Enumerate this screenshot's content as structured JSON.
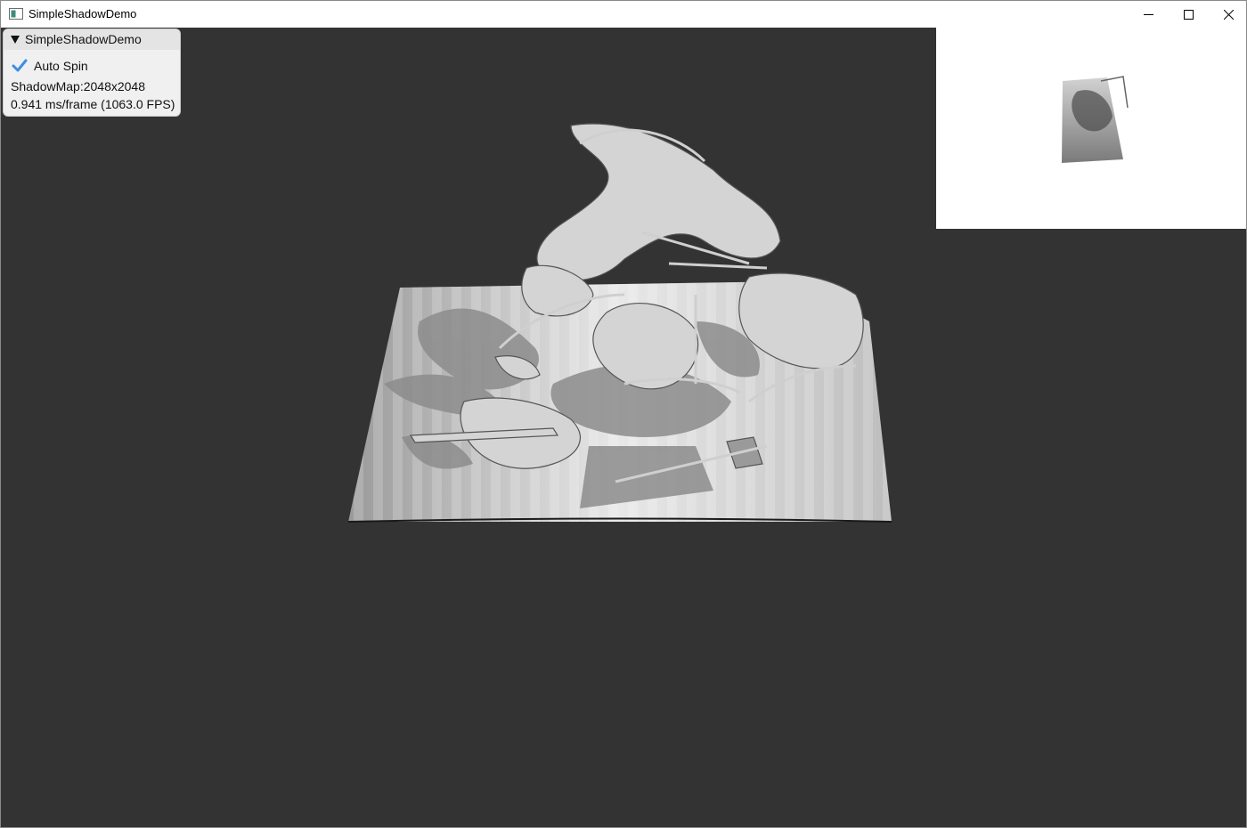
{
  "window": {
    "title": "SimpleShadowDemo",
    "controls": [
      "minimize-icon",
      "maximize-icon",
      "close-icon"
    ]
  },
  "panel": {
    "title": "SimpleShadowDemo",
    "auto_spin": {
      "label": "Auto Spin",
      "checked": true
    },
    "shadow_map": "ShadowMap:2048x2048",
    "frame_stats": "0.941 ms/frame (1063.0 FPS)"
  },
  "colors": {
    "viewport_bg": "#333333",
    "check_accent": "#3c8ee6",
    "panel_bg": "#f0f0f0"
  }
}
